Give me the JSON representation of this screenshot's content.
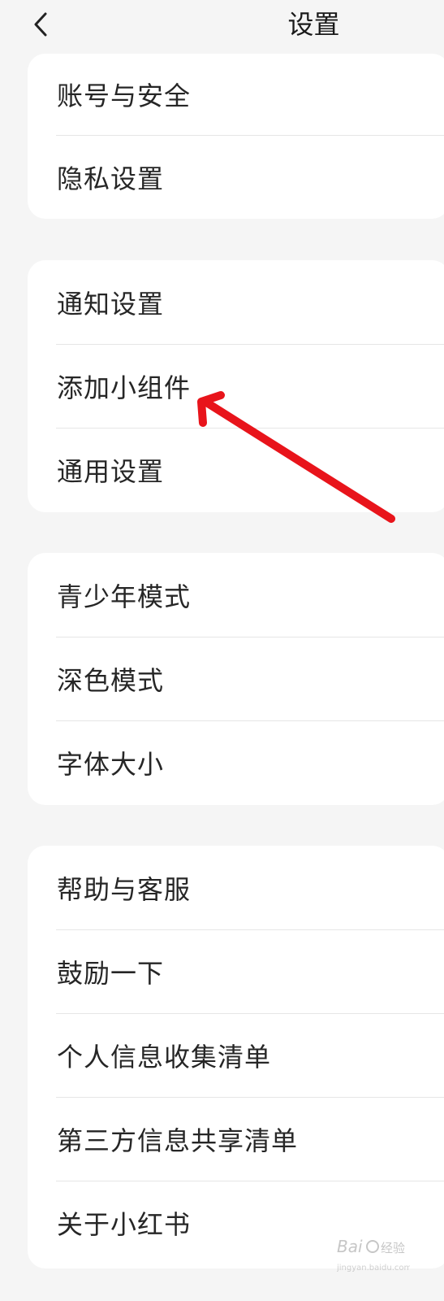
{
  "header": {
    "title": "设置",
    "back_icon": "chevron-left-icon"
  },
  "groups": [
    {
      "items": [
        {
          "label": "账号与安全"
        },
        {
          "label": "隐私设置"
        }
      ]
    },
    {
      "items": [
        {
          "label": "通知设置"
        },
        {
          "label": "添加小组件"
        },
        {
          "label": "通用设置"
        }
      ]
    },
    {
      "items": [
        {
          "label": "青少年模式"
        },
        {
          "label": "深色模式"
        },
        {
          "label": "字体大小"
        }
      ]
    },
    {
      "items": [
        {
          "label": "帮助与客服"
        },
        {
          "label": "鼓励一下"
        },
        {
          "label": "个人信息收集清单"
        },
        {
          "label": "第三方信息共享清单"
        },
        {
          "label": "关于小红书"
        }
      ]
    }
  ],
  "annotation": {
    "arrow_color": "#e8141b"
  },
  "watermark": {
    "brand": "Baidu",
    "text": "经验",
    "url": "jingyan.baidu.com"
  }
}
